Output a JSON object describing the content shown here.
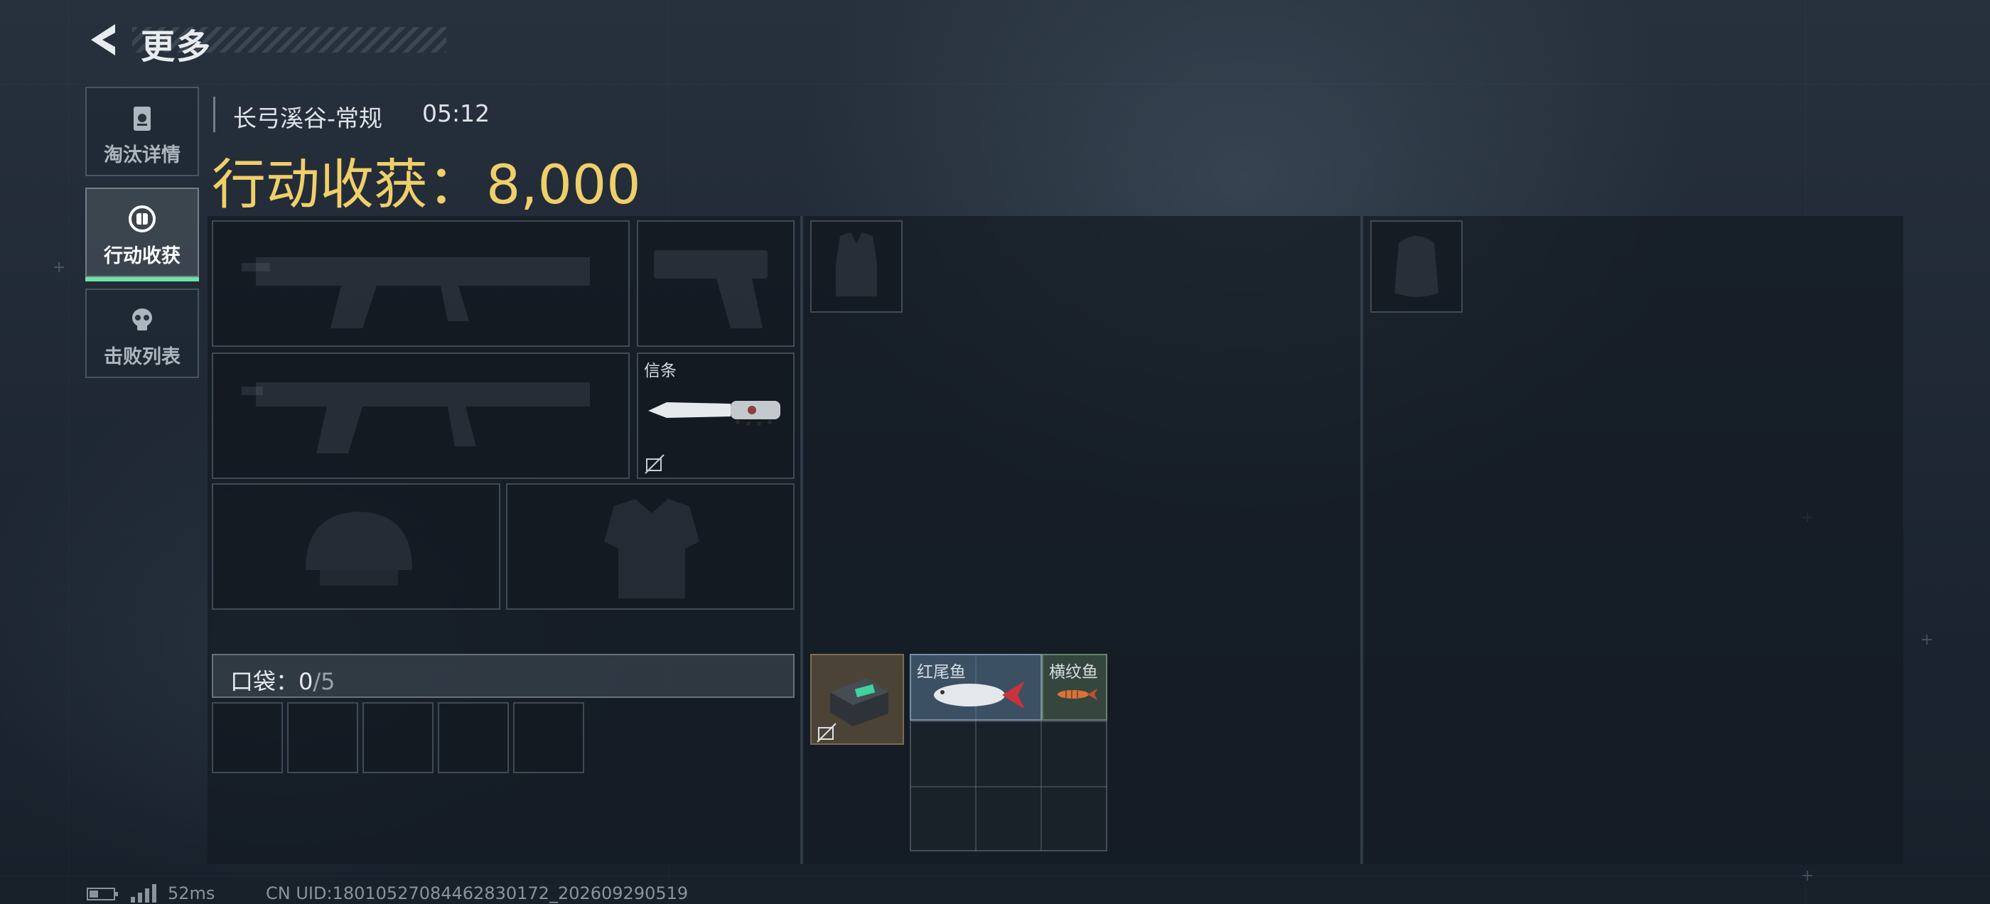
{
  "header": {
    "title": "更多",
    "back_icon": "back-arrow-icon"
  },
  "tabs": [
    {
      "label": "淘汰详情",
      "icon": "dogtag-icon",
      "active": false
    },
    {
      "label": "行动收获",
      "icon": "loot-icon",
      "active": true
    },
    {
      "label": "击败列表",
      "icon": "skull-icon",
      "active": false
    }
  ],
  "match": {
    "map": "长弓溪谷-常规",
    "time": "05:12"
  },
  "harvest": {
    "label": "行动收获：",
    "value": "8,000",
    "color": "#f0cf6a"
  },
  "equipment": {
    "melee_label": "信条",
    "pocket_label": "口袋：",
    "pocket_count": "0",
    "pocket_capacity": "/5"
  },
  "loot": {
    "fish1_label": "红尾鱼",
    "fish2_label": "横纹鱼"
  },
  "status": {
    "ping": "52ms",
    "uid": "CN UID:18010527084462830172_202609290519"
  },
  "colors": {
    "accent_active": "#6fe3a4",
    "harvest": "#f0cf6a"
  }
}
